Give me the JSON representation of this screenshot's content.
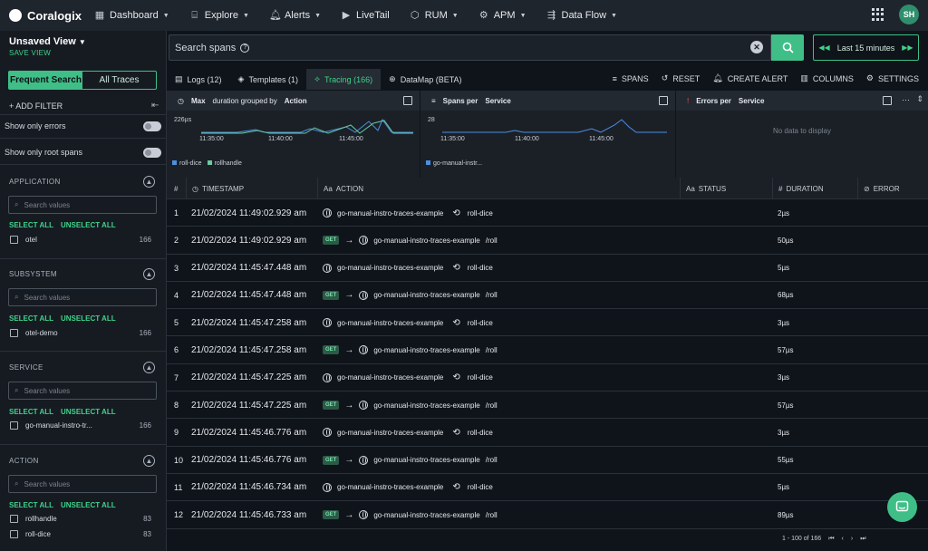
{
  "nav": {
    "brand": "Coralogix",
    "items": [
      {
        "label": "Dashboard",
        "icon": "dashboard-icon",
        "caret": true
      },
      {
        "label": "Explore",
        "icon": "explore-icon",
        "caret": true
      },
      {
        "label": "Alerts",
        "icon": "bell-icon",
        "caret": true
      },
      {
        "label": "LiveTail",
        "icon": "play-icon",
        "caret": false
      },
      {
        "label": "RUM",
        "icon": "rum-icon",
        "caret": true
      },
      {
        "label": "APM",
        "icon": "apm-icon",
        "caret": true
      },
      {
        "label": "Data Flow",
        "icon": "data-flow-icon",
        "caret": true
      }
    ],
    "avatar": "SH"
  },
  "sidebar": {
    "view_title": "Unsaved View",
    "save_view": "SAVE VIEW",
    "tabs": [
      "Frequent Search",
      "All Traces"
    ],
    "add_filter": "ADD FILTER",
    "toggle_errors": "Show only errors",
    "toggle_root": "Show only root spans",
    "select_all": "SELECT ALL",
    "unselect_all": "UNSELECT ALL",
    "search_placeholder": "Search values",
    "sections": [
      {
        "title": "APPLICATION",
        "options": [
          {
            "label": "otel",
            "count": "166"
          }
        ]
      },
      {
        "title": "SUBSYSTEM",
        "options": [
          {
            "label": "otel-demo",
            "count": "166"
          }
        ]
      },
      {
        "title": "SERVICE",
        "options": [
          {
            "label": "go-manual-instro-tr...",
            "count": "166"
          }
        ]
      },
      {
        "title": "ACTION",
        "options": [
          {
            "label": "rollhandle",
            "count": "83"
          },
          {
            "label": "roll-dice",
            "count": "83"
          }
        ]
      }
    ]
  },
  "search": {
    "placeholder": "Search spans",
    "time_range": "Last 15 minutes"
  },
  "tabs": [
    {
      "label": "Logs (12)",
      "icon": "logs-icon"
    },
    {
      "label": "Templates (1)",
      "icon": "templates-icon"
    },
    {
      "label": "Tracing (166)",
      "icon": "tracing-icon",
      "active": true
    },
    {
      "label": "DataMap (BETA)",
      "icon": "datamap-icon"
    }
  ],
  "actions": [
    "SPANS",
    "RESET",
    "CREATE ALERT",
    "COLUMNS",
    "SETTINGS"
  ],
  "widgets": {
    "w1": {
      "title_a": "Max",
      "title_b": "duration grouped by",
      "title_c": "Action",
      "ytop": "226µs",
      "xticks": [
        "11:35:00",
        "11:40:00",
        "11:45:00"
      ],
      "legend": [
        "roll-dice",
        "rollhandle"
      ]
    },
    "w2": {
      "title_a": "Spans per",
      "title_b": "Service",
      "ytop": "28",
      "xticks": [
        "11:35:00",
        "11:40:00",
        "11:45:00"
      ],
      "legend": [
        "go-manual-instr..."
      ]
    },
    "w3": {
      "title_a": "Errors per",
      "title_b": "Service",
      "empty": "No data to display"
    }
  },
  "colors": {
    "accent": "#3fbf87",
    "series_blue": "#4a8fe0",
    "series_green": "#6cc8a0"
  },
  "table": {
    "headers": {
      "num": "#",
      "timestamp": "TIMESTAMP",
      "action": "ACTION",
      "status": "STATUS",
      "duration": "DURATION",
      "error": "ERROR"
    },
    "rows": [
      {
        "num": "1",
        "ts": "21/02/2024 11:49:02.929 am",
        "get": false,
        "service": "go-manual-instro-traces-example",
        "op": "roll-dice",
        "dur": "2µs"
      },
      {
        "num": "2",
        "ts": "21/02/2024 11:49:02.929 am",
        "get": true,
        "service": "go-manual-instro-traces-example",
        "op": "/roll",
        "dur": "50µs"
      },
      {
        "num": "3",
        "ts": "21/02/2024 11:45:47.448 am",
        "get": false,
        "service": "go-manual-instro-traces-example",
        "op": "roll-dice",
        "dur": "5µs"
      },
      {
        "num": "4",
        "ts": "21/02/2024 11:45:47.448 am",
        "get": true,
        "service": "go-manual-instro-traces-example",
        "op": "/roll",
        "dur": "68µs"
      },
      {
        "num": "5",
        "ts": "21/02/2024 11:45:47.258 am",
        "get": false,
        "service": "go-manual-instro-traces-example",
        "op": "roll-dice",
        "dur": "3µs"
      },
      {
        "num": "6",
        "ts": "21/02/2024 11:45:47.258 am",
        "get": true,
        "service": "go-manual-instro-traces-example",
        "op": "/roll",
        "dur": "57µs"
      },
      {
        "num": "7",
        "ts": "21/02/2024 11:45:47.225 am",
        "get": false,
        "service": "go-manual-instro-traces-example",
        "op": "roll-dice",
        "dur": "3µs"
      },
      {
        "num": "8",
        "ts": "21/02/2024 11:45:47.225 am",
        "get": true,
        "service": "go-manual-instro-traces-example",
        "op": "/roll",
        "dur": "57µs"
      },
      {
        "num": "9",
        "ts": "21/02/2024 11:45:46.776 am",
        "get": false,
        "service": "go-manual-instro-traces-example",
        "op": "roll-dice",
        "dur": "3µs"
      },
      {
        "num": "10",
        "ts": "21/02/2024 11:45:46.776 am",
        "get": true,
        "service": "go-manual-instro-traces-example",
        "op": "/roll",
        "dur": "55µs"
      },
      {
        "num": "11",
        "ts": "21/02/2024 11:45:46.734 am",
        "get": false,
        "service": "go-manual-instro-traces-example",
        "op": "roll-dice",
        "dur": "5µs"
      },
      {
        "num": "12",
        "ts": "21/02/2024 11:45:46.733 am",
        "get": true,
        "service": "go-manual-instro-traces-example",
        "op": "/roll",
        "dur": "89µs"
      }
    ],
    "get_label": "GET",
    "pager": "1 - 100 of 166"
  }
}
